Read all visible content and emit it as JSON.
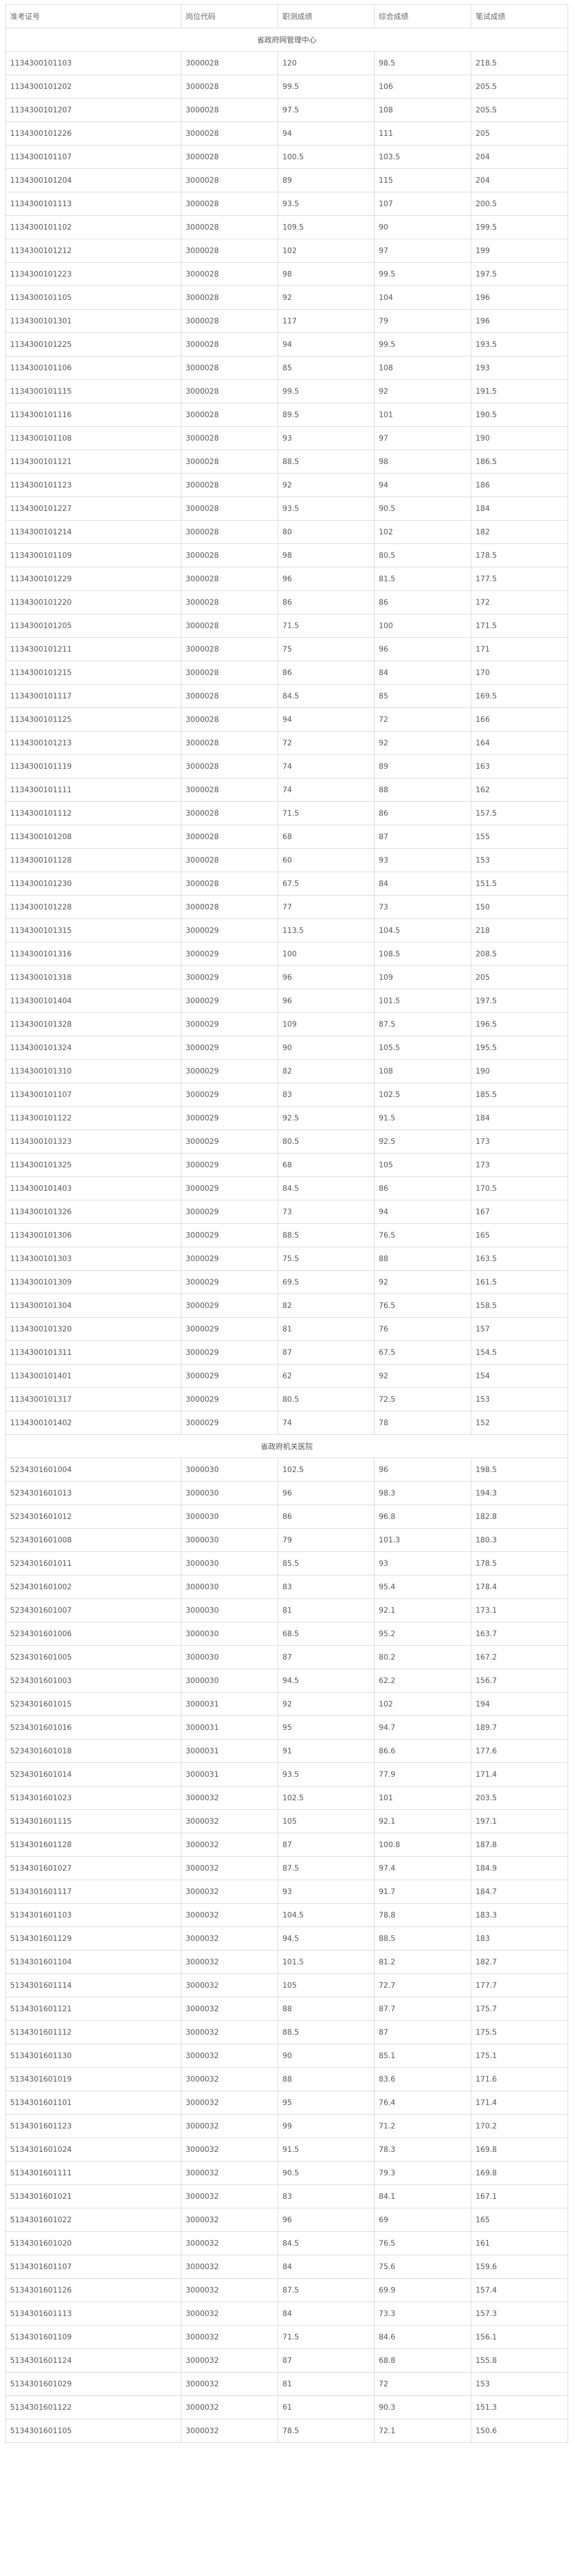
{
  "headers": [
    "准考证号",
    "岗位代码",
    "职测成绩",
    "综合成绩",
    "笔试成绩"
  ],
  "sections": [
    {
      "title": "省政府网管理中心",
      "rows": [
        [
          "1134300101103",
          "3000028",
          "120",
          "98.5",
          "218.5"
        ],
        [
          "1134300101202",
          "3000028",
          "99.5",
          "106",
          "205.5"
        ],
        [
          "1134300101207",
          "3000028",
          "97.5",
          "108",
          "205.5"
        ],
        [
          "1134300101226",
          "3000028",
          "94",
          "111",
          "205"
        ],
        [
          "1134300101107",
          "3000028",
          "100.5",
          "103.5",
          "204"
        ],
        [
          "1134300101204",
          "3000028",
          "89",
          "115",
          "204"
        ],
        [
          "1134300101113",
          "3000028",
          "93.5",
          "107",
          "200.5"
        ],
        [
          "1134300101102",
          "3000028",
          "109.5",
          "90",
          "199.5"
        ],
        [
          "1134300101212",
          "3000028",
          "102",
          "97",
          "199"
        ],
        [
          "1134300101223",
          "3000028",
          "98",
          "99.5",
          "197.5"
        ],
        [
          "1134300101105",
          "3000028",
          "92",
          "104",
          "196"
        ],
        [
          "1134300101301",
          "3000028",
          "117",
          "79",
          "196"
        ],
        [
          "1134300101225",
          "3000028",
          "94",
          "99.5",
          "193.5"
        ],
        [
          "1134300101106",
          "3000028",
          "85",
          "108",
          "193"
        ],
        [
          "1134300101115",
          "3000028",
          "99.5",
          "92",
          "191.5"
        ],
        [
          "1134300101116",
          "3000028",
          "89.5",
          "101",
          "190.5"
        ],
        [
          "1134300101108",
          "3000028",
          "93",
          "97",
          "190"
        ],
        [
          "1134300101121",
          "3000028",
          "88.5",
          "98",
          "186.5"
        ],
        [
          "1134300101123",
          "3000028",
          "92",
          "94",
          "186"
        ],
        [
          "1134300101227",
          "3000028",
          "93.5",
          "90.5",
          "184"
        ],
        [
          "1134300101214",
          "3000028",
          "80",
          "102",
          "182"
        ],
        [
          "1134300101109",
          "3000028",
          "98",
          "80.5",
          "178.5"
        ],
        [
          "1134300101229",
          "3000028",
          "96",
          "81.5",
          "177.5"
        ],
        [
          "1134300101220",
          "3000028",
          "86",
          "86",
          "172"
        ],
        [
          "1134300101205",
          "3000028",
          "71.5",
          "100",
          "171.5"
        ],
        [
          "1134300101211",
          "3000028",
          "75",
          "96",
          "171"
        ],
        [
          "1134300101215",
          "3000028",
          "86",
          "84",
          "170"
        ],
        [
          "1134300101117",
          "3000028",
          "84.5",
          "85",
          "169.5"
        ],
        [
          "1134300101125",
          "3000028",
          "94",
          "72",
          "166"
        ],
        [
          "1134300101213",
          "3000028",
          "72",
          "92",
          "164"
        ],
        [
          "1134300101119",
          "3000028",
          "74",
          "89",
          "163"
        ],
        [
          "1134300101111",
          "3000028",
          "74",
          "88",
          "162"
        ],
        [
          "1134300101112",
          "3000028",
          "71.5",
          "86",
          "157.5"
        ],
        [
          "1134300101208",
          "3000028",
          "68",
          "87",
          "155"
        ],
        [
          "1134300101128",
          "3000028",
          "60",
          "93",
          "153"
        ],
        [
          "1134300101230",
          "3000028",
          "67.5",
          "84",
          "151.5"
        ],
        [
          "1134300101228",
          "3000028",
          "77",
          "73",
          "150"
        ],
        [
          "1134300101315",
          "3000029",
          "113.5",
          "104.5",
          "218"
        ],
        [
          "1134300101316",
          "3000029",
          "100",
          "108.5",
          "208.5"
        ],
        [
          "1134300101318",
          "3000029",
          "96",
          "109",
          "205"
        ],
        [
          "1134300101404",
          "3000029",
          "96",
          "101.5",
          "197.5"
        ],
        [
          "1134300101328",
          "3000029",
          "109",
          "87.5",
          "196.5"
        ],
        [
          "1134300101324",
          "3000029",
          "90",
          "105.5",
          "195.5"
        ],
        [
          "1134300101310",
          "3000029",
          "82",
          "108",
          "190"
        ],
        [
          "1134300101107",
          "3000029",
          "83",
          "102.5",
          "185.5"
        ],
        [
          "1134300101122",
          "3000029",
          "92.5",
          "91.5",
          "184"
        ],
        [
          "1134300101323",
          "3000029",
          "80.5",
          "92.5",
          "173"
        ],
        [
          "1134300101325",
          "3000029",
          "68",
          "105",
          "173"
        ],
        [
          "1134300101403",
          "3000029",
          "84.5",
          "86",
          "170.5"
        ],
        [
          "1134300101326",
          "3000029",
          "73",
          "94",
          "167"
        ],
        [
          "1134300101306",
          "3000029",
          "88.5",
          "76.5",
          "165"
        ],
        [
          "1134300101303",
          "3000029",
          "75.5",
          "88",
          "163.5"
        ],
        [
          "1134300101309",
          "3000029",
          "69.5",
          "92",
          "161.5"
        ],
        [
          "1134300101304",
          "3000029",
          "82",
          "76.5",
          "158.5"
        ],
        [
          "1134300101320",
          "3000029",
          "81",
          "76",
          "157"
        ],
        [
          "1134300101311",
          "3000029",
          "87",
          "67.5",
          "154.5"
        ],
        [
          "1134300101401",
          "3000029",
          "62",
          "92",
          "154"
        ],
        [
          "1134300101317",
          "3000029",
          "80.5",
          "72.5",
          "153"
        ],
        [
          "1134300101402",
          "3000029",
          "74",
          "78",
          "152"
        ]
      ]
    },
    {
      "title": "省政府机关医院",
      "rows": [
        [
          "5234301601004",
          "3000030",
          "102.5",
          "96",
          "198.5"
        ],
        [
          "5234301601013",
          "3000030",
          "96",
          "98.3",
          "194.3"
        ],
        [
          "5234301601012",
          "3000030",
          "86",
          "96.8",
          "182.8"
        ],
        [
          "5234301601008",
          "3000030",
          "79",
          "101.3",
          "180.3"
        ],
        [
          "5234301601011",
          "3000030",
          "85.5",
          "93",
          "178.5"
        ],
        [
          "5234301601002",
          "3000030",
          "83",
          "95.4",
          "178.4"
        ],
        [
          "5234301601007",
          "3000030",
          "81",
          "92.1",
          "173.1"
        ],
        [
          "5234301601006",
          "3000030",
          "68.5",
          "95.2",
          "163.7"
        ],
        [
          "5234301601005",
          "3000030",
          "87",
          "80.2",
          "167.2"
        ],
        [
          "5234301601003",
          "3000030",
          "94.5",
          "62.2",
          "156.7"
        ],
        [
          "5234301601015",
          "3000031",
          "92",
          "102",
          "194"
        ],
        [
          "5234301601016",
          "3000031",
          "95",
          "94.7",
          "189.7"
        ],
        [
          "5234301601018",
          "3000031",
          "91",
          "86.6",
          "177.6"
        ],
        [
          "5234301601014",
          "3000031",
          "93.5",
          "77.9",
          "171.4"
        ],
        [
          "5134301601023",
          "3000032",
          "102.5",
          "101",
          "203.5"
        ],
        [
          "5134301601115",
          "3000032",
          "105",
          "92.1",
          "197.1"
        ],
        [
          "5134301601128",
          "3000032",
          "87",
          "100.8",
          "187.8"
        ],
        [
          "5134301601027",
          "3000032",
          "87.5",
          "97.4",
          "184.9"
        ],
        [
          "5134301601117",
          "3000032",
          "93",
          "91.7",
          "184.7"
        ],
        [
          "5134301601103",
          "3000032",
          "104.5",
          "78.8",
          "183.3"
        ],
        [
          "5134301601129",
          "3000032",
          "94.5",
          "88.5",
          "183"
        ],
        [
          "5134301601104",
          "3000032",
          "101.5",
          "81.2",
          "182.7"
        ],
        [
          "5134301601114",
          "3000032",
          "105",
          "72.7",
          "177.7"
        ],
        [
          "5134301601121",
          "3000032",
          "88",
          "87.7",
          "175.7"
        ],
        [
          "5134301601112",
          "3000032",
          "88.5",
          "87",
          "175.5"
        ],
        [
          "5134301601130",
          "3000032",
          "90",
          "85.1",
          "175.1"
        ],
        [
          "5134301601019",
          "3000032",
          "88",
          "83.6",
          "171.6"
        ],
        [
          "5134301601101",
          "3000032",
          "95",
          "76.4",
          "171.4"
        ],
        [
          "5134301601123",
          "3000032",
          "99",
          "71.2",
          "170.2"
        ],
        [
          "5134301601024",
          "3000032",
          "91.5",
          "78.3",
          "169.8"
        ],
        [
          "5134301601111",
          "3000032",
          "90.5",
          "79.3",
          "169.8"
        ],
        [
          "5134301601021",
          "3000032",
          "83",
          "84.1",
          "167.1"
        ],
        [
          "5134301601022",
          "3000032",
          "96",
          "69",
          "165"
        ],
        [
          "5134301601020",
          "3000032",
          "84.5",
          "76.5",
          "161"
        ],
        [
          "5134301601107",
          "3000032",
          "84",
          "75.6",
          "159.6"
        ],
        [
          "5134301601126",
          "3000032",
          "87.5",
          "69.9",
          "157.4"
        ],
        [
          "5134301601113",
          "3000032",
          "84",
          "73.3",
          "157.3"
        ],
        [
          "5134301601109",
          "3000032",
          "71.5",
          "84.6",
          "156.1"
        ],
        [
          "5134301601124",
          "3000032",
          "87",
          "68.8",
          "155.8"
        ],
        [
          "5134301601029",
          "3000032",
          "81",
          "72",
          "153"
        ],
        [
          "5134301601122",
          "3000032",
          "61",
          "90.3",
          "151.3"
        ],
        [
          "5134301601105",
          "3000032",
          "78.5",
          "72.1",
          "150.6"
        ]
      ]
    }
  ]
}
